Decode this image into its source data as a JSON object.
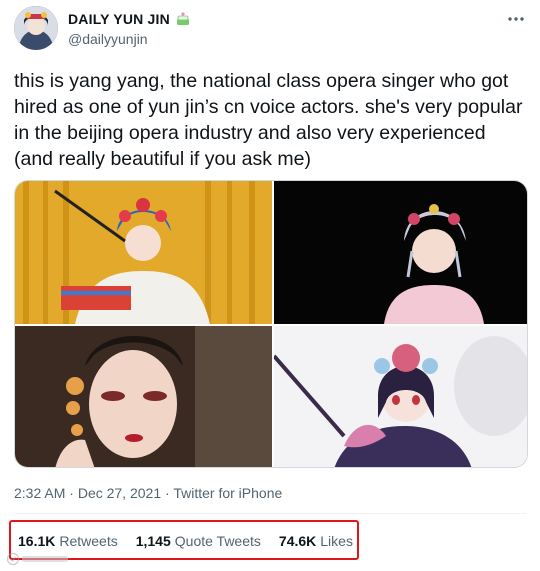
{
  "user": {
    "display_name": "DAILY YUN JIN",
    "badge_icon": "cake-icon",
    "handle": "@dailyyunjin"
  },
  "tweet": {
    "text": "this is yang yang, the national class opera singer who got hired as one of yun jin’s cn voice actors. she's very popular in the beijing opera industry and also very experienced (and really beautiful if you ask me)"
  },
  "media": {
    "images": [
      {
        "desc": "opera-stage-photo"
      },
      {
        "desc": "opera-portrait-black-bg"
      },
      {
        "desc": "opera-makeup-closeup"
      },
      {
        "desc": "yun-jin-character-art"
      }
    ]
  },
  "meta": {
    "time": "2:32 AM",
    "dot": " · ",
    "date": "Dec 27, 2021",
    "source": "Twitter for iPhone"
  },
  "stats": {
    "retweets_count": "16.1K",
    "retweets_label": "Retweets",
    "quotes_count": "1,145",
    "quotes_label": "Quote Tweets",
    "likes_count": "74.6K",
    "likes_label": "Likes"
  },
  "colors": {
    "highlight_box": "#e0151b",
    "secondary_text": "#536471"
  }
}
